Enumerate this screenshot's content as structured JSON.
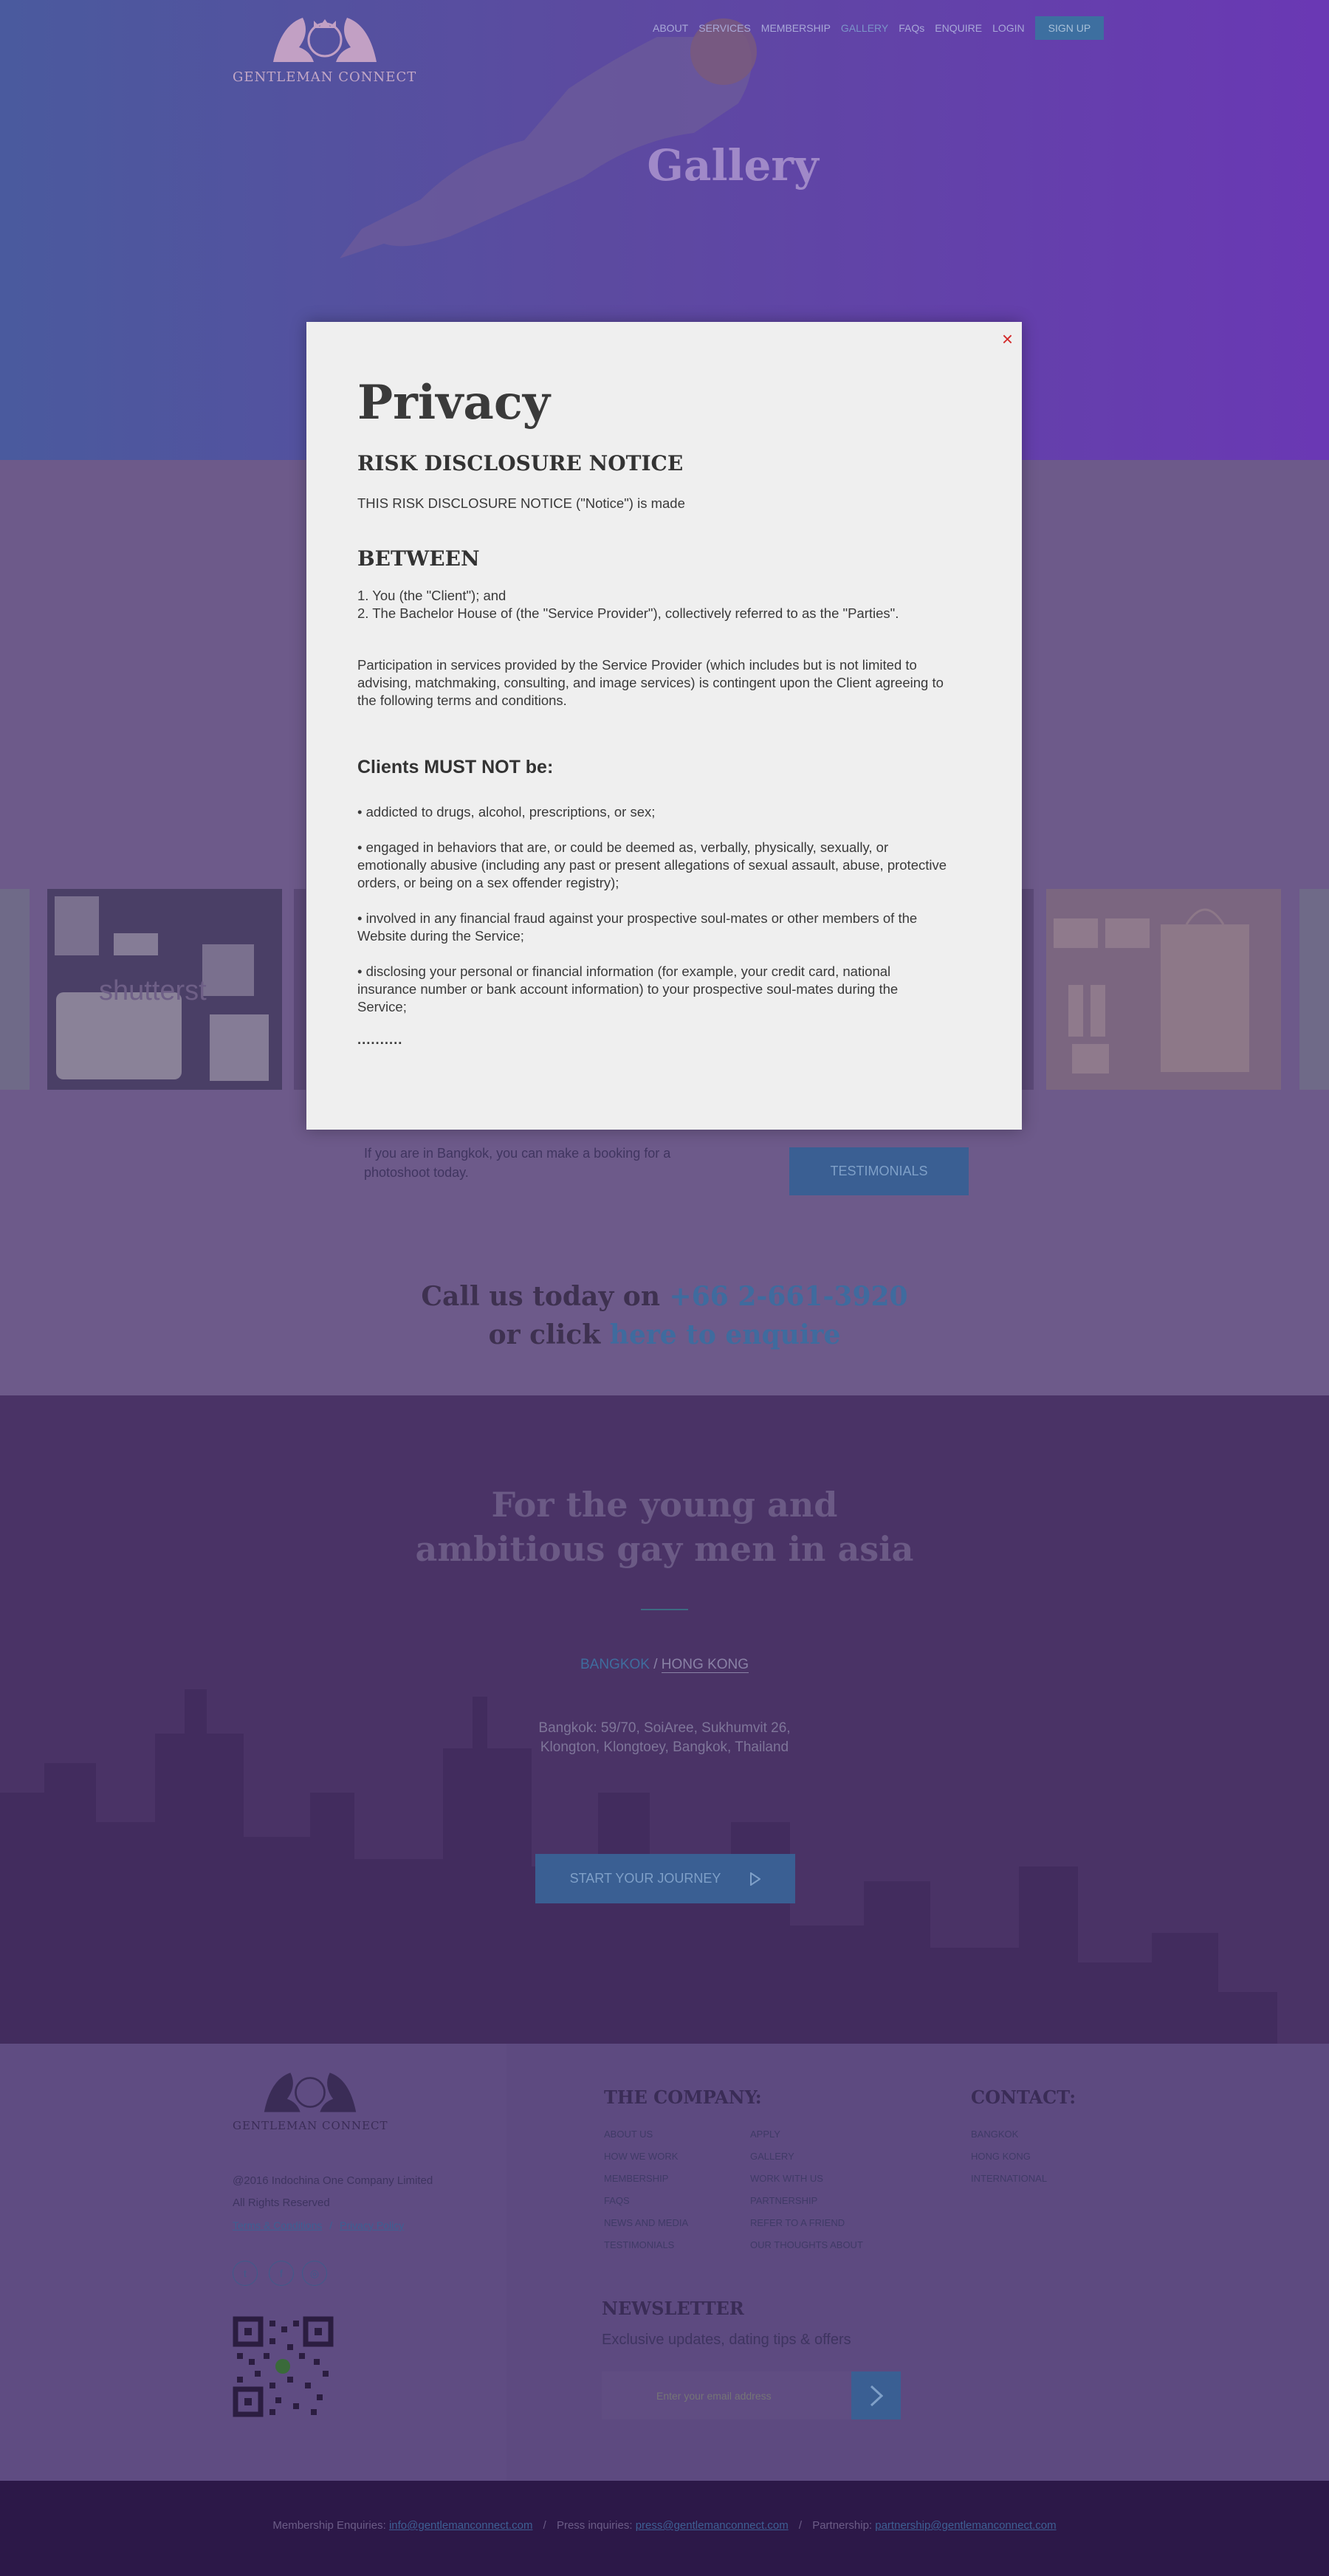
{
  "nav": {
    "items": [
      "ABOUT",
      "SERVICES",
      "MEMBERSHIP",
      "GALLERY",
      "FAQs",
      "ENQUIRE",
      "LOGIN"
    ],
    "signup": "SIGN UP"
  },
  "logo": {
    "monogram": "GC",
    "brand": "GENTLEMAN CONNECT"
  },
  "hero": {
    "title": "Gallery"
  },
  "gallery": {
    "watermark": "shutterst",
    "booking_text": "If you are in Bangkok, you can make a booking for a photoshoot today.",
    "testimonials_button": "TESTIMONIALS",
    "call_prefix": "Call us today on ",
    "phone": "+66 2-661-3920",
    "click_prefix": "or click ",
    "enquire_link": "here to enquire"
  },
  "city": {
    "tagline_line1": "For the young and",
    "tagline_line2": "ambitious gay men in asia",
    "city_selected": "BANGKOK",
    "separator": " / ",
    "city_other": "HONG KONG",
    "address_line1": "Bangkok: 59/70, SoiAree, Sukhumvit 26,",
    "address_line2": "Klongton, Klongtoey, Bangkok, Thailand",
    "journey_button": "START YOUR JOURNEY"
  },
  "footer": {
    "copyright": "@2016 Indochina One Company Limited",
    "rights": "All Rights Reserved",
    "terms": "Terms & Conditions",
    "divider": "/",
    "privacy": "Privacy Policy",
    "company_heading": "THE COMPANY:",
    "company_col1": [
      "ABOUT US",
      "HOW WE WORK",
      "MEMBERSHIP",
      "FAQS",
      "NEWS AND MEDIA",
      "TESTIMONIALS"
    ],
    "company_col2": [
      "APPLY",
      "GALLERY",
      "WORK WITH US",
      "PARTNERSHIP",
      "REFER TO A FRIEND",
      "OUR THOUGHTS ABOUT"
    ],
    "contact_heading": "CONTACT:",
    "contact_items": [
      "BANGKOK",
      "HONG KONG",
      "INTERNATIONAL"
    ],
    "newsletter_heading": "NEWSLETTER",
    "newsletter_sub": "Exclusive updates, dating tips & offers",
    "newsletter_placeholder": "Enter your email address"
  },
  "bottom": {
    "membership_label": "Membership Enquiries: ",
    "membership_email": "info@gentlemanconnect.com",
    "press_label": "Press inquiries: ",
    "press_email": "press@gentlemanconnect.com",
    "partnership_label": "Partnership: ",
    "partnership_email": "partnership@gentlemanconnect.com",
    "sep": "/"
  },
  "modal": {
    "close": "×",
    "title": "Privacy",
    "h_notice": "RISK DISCLOSURE NOTICE",
    "p_notice": "THIS RISK DISCLOSURE NOTICE (\"Notice\") is made",
    "h_between": "BETWEEN",
    "p_between1": "1. You (the \"Client\"); and",
    "p_between2": "2. The Bachelor House of (the \"Service Provider\"), collectively referred to as the \"Parties\".",
    "p_participation": "Participation in services provided by the Service Provider (which includes but is not limited to advising, matchmaking, consulting, and image services) is contingent upon the Client agreeing to the following terms and conditions.",
    "h_clients": "Clients MUST NOT be:",
    "bullets": [
      "•  addicted to drugs, alcohol, prescriptions, or sex;",
      "•  engaged in behaviors that are, or could be deemed as, verbally, physically, sexually, or emotionally abusive (including any past or present allegations of sexual assault, abuse, protective orders, or being on a sex offender registry);",
      "•  involved in any financial fraud against your prospective soul-mates or other members of the Website during the Service;",
      "•  disclosing your personal or financial information (for example, your credit card, national insurance number or bank account information) to your prospective soul-mates during the Service;"
    ],
    "ellipsis": ".........."
  },
  "colors": {
    "accent_blue": "#3a5f93",
    "close_red": "#d32a2a",
    "modal_bg": "#efefef"
  }
}
